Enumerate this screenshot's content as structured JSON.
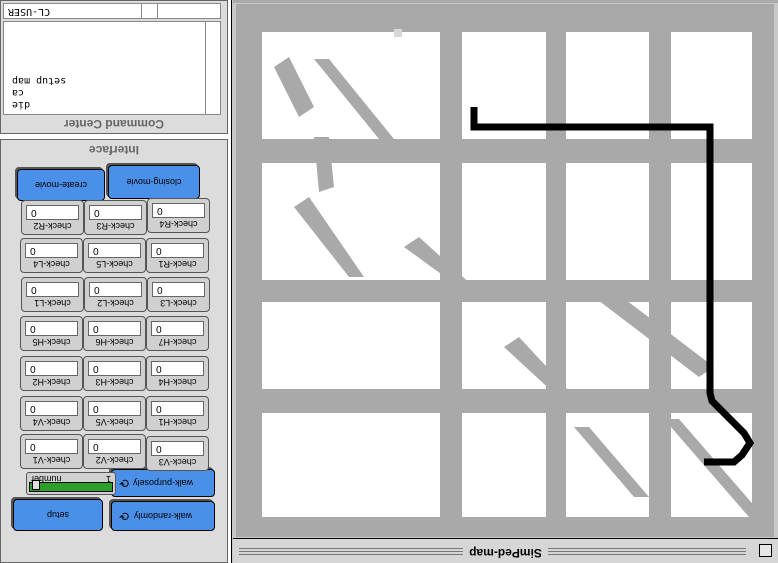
{
  "map_window": {
    "title": "SimPed-map"
  },
  "command_center": {
    "title": "Command Center",
    "agent": "CL-USER",
    "output_lines": [
      "setup map",
      "ca",
      "die"
    ]
  },
  "interface": {
    "title": "Interface",
    "buttons": {
      "create_movie": "create-movie",
      "closing_movie": "closing-movie",
      "walk_purposely": "walk-purposely",
      "walk_randomly": "walk-randomly",
      "setup": "setup"
    },
    "slider": {
      "label": "number",
      "value": "1"
    },
    "monitors": [
      {
        "label": "check-R2",
        "value": "0"
      },
      {
        "label": "check-R3",
        "value": "0"
      },
      {
        "label": "check-R4",
        "value": "0"
      },
      {
        "label": "check-L4",
        "value": "0"
      },
      {
        "label": "check-L5",
        "value": "0"
      },
      {
        "label": "check-R1",
        "value": "0"
      },
      {
        "label": "check-L1",
        "value": "0"
      },
      {
        "label": "check-L2",
        "value": "0"
      },
      {
        "label": "check-L3",
        "value": "0"
      },
      {
        "label": "check-H5",
        "value": "0"
      },
      {
        "label": "check-H6",
        "value": "0"
      },
      {
        "label": "check-H7",
        "value": "0"
      },
      {
        "label": "check-H2",
        "value": "0"
      },
      {
        "label": "check-H3",
        "value": "0"
      },
      {
        "label": "check-H4",
        "value": "0"
      },
      {
        "label": "check-V4",
        "value": "0"
      },
      {
        "label": "check-V5",
        "value": "0"
      },
      {
        "label": "check-H1",
        "value": "0"
      },
      {
        "label": "check-V1",
        "value": "0"
      },
      {
        "label": "check-V2",
        "value": "0"
      },
      {
        "label": "check-V3",
        "value": "0"
      }
    ]
  },
  "colors": {
    "road": "#a9a9a9",
    "path": "#000000",
    "button": "#4a90e8",
    "slider": "#2aa02a"
  }
}
